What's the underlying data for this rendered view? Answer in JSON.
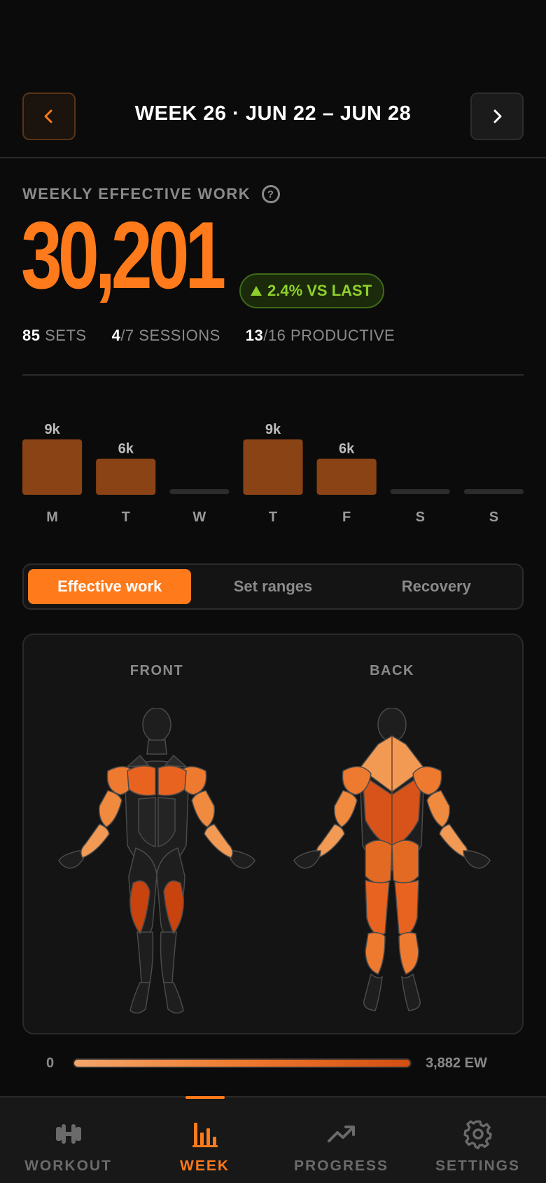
{
  "header": {
    "title": "WEEK 26 · JUN 22 – JUN 28"
  },
  "summary": {
    "label": "WEEKLY EFFECTIVE WORK",
    "total": "30,201",
    "delta": "2.4% VS LAST",
    "sets_value": "85",
    "sets_label": " SETS",
    "sessions_value": "4",
    "sessions_label": "/7 SESSIONS",
    "productive_value": "13",
    "productive_label": "/16 PRODUCTIVE"
  },
  "chart_data": {
    "type": "bar",
    "categories": [
      "M",
      "T",
      "W",
      "T",
      "F",
      "S",
      "S"
    ],
    "values": [
      9000,
      6000,
      0,
      9000,
      6000,
      0,
      0
    ],
    "data_labels": [
      "9k",
      "6k",
      "",
      "9k",
      "6k",
      "",
      ""
    ],
    "colors": {
      "bar": "#8a4314",
      "empty": "#2c2c2c",
      "label": "#bdbdbd",
      "day": "#9a9a9a"
    }
  },
  "segments": [
    "Effective work",
    "Set ranges",
    "Recovery"
  ],
  "active_segment": 0,
  "body_map": {
    "front_label": "FRONT",
    "back_label": "BACK"
  },
  "legend": {
    "min": "0",
    "max": "3,882 EW"
  },
  "tabs": [
    {
      "label": "WORKOUT",
      "icon": "dumbbell-icon"
    },
    {
      "label": "WEEK",
      "icon": "bar-chart-icon"
    },
    {
      "label": "PROGRESS",
      "icon": "trend-up-icon"
    },
    {
      "label": "SETTINGS",
      "icon": "gear-icon"
    }
  ],
  "active_tab": 1,
  "colors": {
    "accent": "#ff7a1a",
    "positive": "#8ed12b",
    "background": "#0b0b0b"
  }
}
